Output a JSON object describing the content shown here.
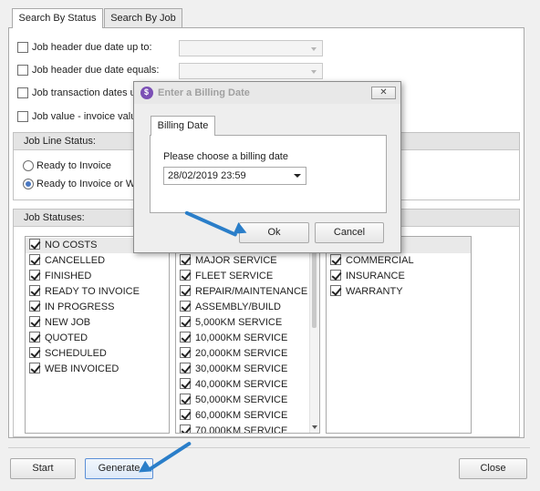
{
  "tabs": [
    {
      "label": "Search By Status",
      "active": true
    },
    {
      "label": "Search By Job",
      "active": false
    }
  ],
  "filters": [
    {
      "label": "Job header due date up to:",
      "checked": false
    },
    {
      "label": "Job header due date equals:",
      "checked": false
    },
    {
      "label": "Job transaction dates u",
      "checked": false
    },
    {
      "label": "Job value - invoice valu",
      "checked": false
    }
  ],
  "job_line_status": {
    "title": "Job Line Status:",
    "options": [
      {
        "label": "Ready to Invoice",
        "selected": false
      },
      {
        "label": "Ready to Invoice or W",
        "selected": true
      }
    ]
  },
  "job_statuses": {
    "title": "Job Statuses:",
    "list1": [
      {
        "label": "NO COSTS",
        "checked": true
      },
      {
        "label": "CANCELLED",
        "checked": true
      },
      {
        "label": "FINISHED",
        "checked": true
      },
      {
        "label": "READY TO INVOICE",
        "checked": true
      },
      {
        "label": "IN PROGRESS",
        "checked": true
      },
      {
        "label": "NEW JOB",
        "checked": true
      },
      {
        "label": "QUOTED",
        "checked": true
      },
      {
        "label": "SCHEDULED",
        "checked": true
      },
      {
        "label": "WEB INVOICED",
        "checked": true
      }
    ],
    "list2": [
      {
        "label": "MAJOR SERVICE",
        "checked": true
      },
      {
        "label": "FLEET SERVICE",
        "checked": true
      },
      {
        "label": "REPAIR/MAINTENANCE",
        "checked": true
      },
      {
        "label": "ASSEMBLY/BUILD",
        "checked": true
      },
      {
        "label": "5,000KM SERVICE",
        "checked": true
      },
      {
        "label": "10,000KM SERVICE",
        "checked": true
      },
      {
        "label": "20,000KM SERVICE",
        "checked": true
      },
      {
        "label": "30,000KM SERVICE",
        "checked": true
      },
      {
        "label": "40,000KM SERVICE",
        "checked": true
      },
      {
        "label": "50,000KM SERVICE",
        "checked": true
      },
      {
        "label": "60,000KM SERVICE",
        "checked": true
      },
      {
        "label": "70,000KM SERVICE",
        "checked": true
      }
    ],
    "list3": [
      {
        "label": "COMMERCIAL",
        "checked": true
      },
      {
        "label": "INSURANCE",
        "checked": true
      },
      {
        "label": "WARRANTY",
        "checked": true
      }
    ]
  },
  "buttons": {
    "start": "Start",
    "generate": "Generate",
    "close": "Close"
  },
  "dialog": {
    "title": "Enter a Billing Date",
    "tab": "Billing Date",
    "prompt": "Please choose a billing date",
    "date_value": "28/02/2019 23:59",
    "ok": "Ok",
    "cancel": "Cancel",
    "close_glyph": "✕"
  },
  "colors": {
    "annotation_arrow": "#2a7ec9",
    "app_icon": "#7b4fb5"
  }
}
